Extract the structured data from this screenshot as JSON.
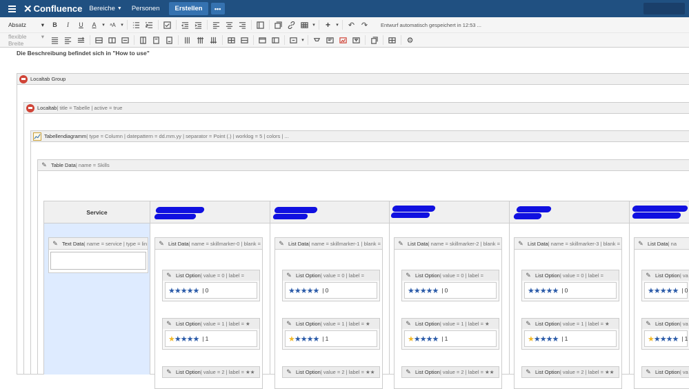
{
  "topbar": {
    "logo": "Confluence",
    "nav_spaces": "Bereiche",
    "nav_people": "Personen",
    "create": "Erstellen",
    "more": "•••"
  },
  "toolbar": {
    "paragraph": "Absatz",
    "width": "flexible Breite",
    "autosave": "Entwurf automatisch gespeichert in 12:53 ..."
  },
  "description": "Die Beschreibung befindet sich in \"How to use\"",
  "macros": {
    "localtab_group": {
      "name": "Localtab Group",
      "params": ""
    },
    "localtab": {
      "name": "Localtab",
      "params": " | title = Tabelle | active = true"
    },
    "chart": {
      "name": "Tabellendiagramm",
      "params": " | type = Column | datepattern = dd.mm.yy | separator = Point (.) | worklog = 5 | colors | ..."
    },
    "table_data": {
      "name": "Table Data",
      "params": " | name = Skills"
    }
  },
  "table": {
    "service_header": "Service",
    "text_data": {
      "name": "Text Data",
      "params": " | name = service | type = lin"
    },
    "columns": [
      {
        "list_name": "List Data",
        "list_params": " | name = skillmarker-0 | blank = fa"
      },
      {
        "list_name": "List Data",
        "list_params": " | name = skillmarker-1 | blank = fa"
      },
      {
        "list_name": "List Data",
        "list_params": " | name = skillmarker-2 | blank = fa"
      },
      {
        "list_name": "List Data",
        "list_params": " | name = skillmarker-3 | blank = fa"
      },
      {
        "list_name": "List Data",
        "list_params": " | na"
      }
    ],
    "options": [
      {
        "name": "List Option",
        "params": " | value = 0 | label = ",
        "value": "0",
        "gold": 0
      },
      {
        "name": "List Option",
        "params": " | value = 1 | label = ★",
        "value": "1",
        "gold": 1
      },
      {
        "name": "List Option",
        "params": " | value = 2 | label = ★★",
        "value": "2",
        "gold": 2
      }
    ],
    "options_narrow": [
      {
        "name": "List Option",
        "params": " | va"
      },
      {
        "name": "List Option",
        "params": " | va"
      },
      {
        "name": "List Option",
        "params": " | va"
      }
    ]
  },
  "colors": {
    "topbar": "#205081",
    "accent": "#3572b0",
    "service_cell": "#deebff",
    "redaction": "#1010e0"
  },
  "icons": [
    "menu-icon",
    "bold-icon",
    "italic-icon",
    "underline-icon",
    "undo-icon",
    "redo-icon",
    "settings-icon",
    "macro-icon",
    "chart-icon",
    "edit-icon",
    "star-icon"
  ]
}
